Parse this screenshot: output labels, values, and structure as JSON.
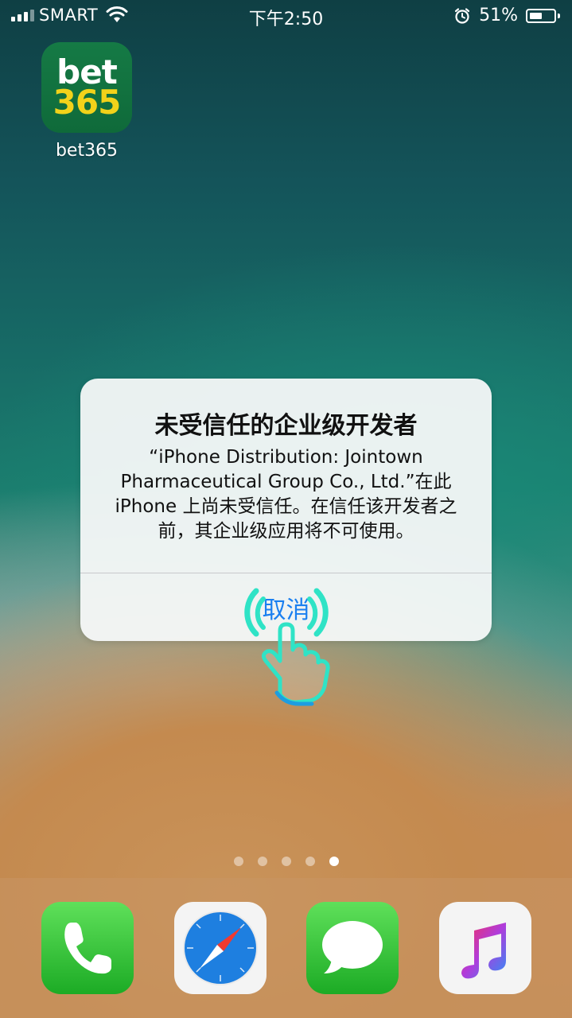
{
  "status_bar": {
    "carrier": "SMART",
    "time": "下午2:50",
    "battery_percent": "51%",
    "battery_level": 0.51,
    "icons": [
      "signal-icon",
      "wifi-icon",
      "alarm-icon",
      "battery-icon"
    ]
  },
  "home": {
    "apps": [
      {
        "label": "bet365",
        "logo_top": "bet",
        "logo_bottom": "365"
      }
    ],
    "page_count": 5,
    "active_page": 5
  },
  "alert": {
    "title": "未受信任的企业级开发者",
    "message": "“iPhone Distribution: Jointown Pharmaceutical Group Co., Ltd.”在此 iPhone 上尚未受信任。在信任该开发者之前，其企业级应用将不可使用。",
    "button_label": "取消"
  },
  "dock": {
    "apps": [
      "phone-icon",
      "safari-icon",
      "messages-icon",
      "music-icon"
    ]
  },
  "colors": {
    "button_blue": "#1a7ff0",
    "bet365_green": "#157a45",
    "bet365_yellow": "#f2d21a",
    "tap_hint_cyan": "#2fe3c6"
  }
}
